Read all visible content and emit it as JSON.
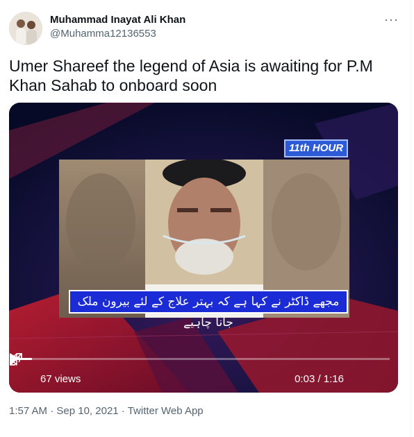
{
  "author": {
    "name": "Muhammad Inayat Ali Khan",
    "handle": "@Muhamma12136553"
  },
  "menu_icon": "more-dots-icon",
  "tweet_text": "Umer Shareef the legend of Asia is awaiting for P.M Khan Sahab to onboard soon",
  "video": {
    "channel_badge": "11th HOUR",
    "ticker_text": "مجھے ڈاکٹر نے کہا ہے کہ بہتر علاج کے لئے بیرون ملک جانا چاہیے",
    "views": "67 views",
    "time": "0:03 / 1:16",
    "progress": 0.04,
    "icons": [
      "play-icon",
      "volume-icon",
      "expand-icon"
    ]
  },
  "meta": {
    "time": "1:57 AM",
    "sep1": " · ",
    "date": "Sep 10, 2021",
    "sep2": " · ",
    "source": "Twitter Web App"
  },
  "colors": {
    "text": "#0f1419",
    "secondary": "#536471",
    "ticker_blue": "#1b2bd6",
    "video_bg": "#0c0f33"
  }
}
